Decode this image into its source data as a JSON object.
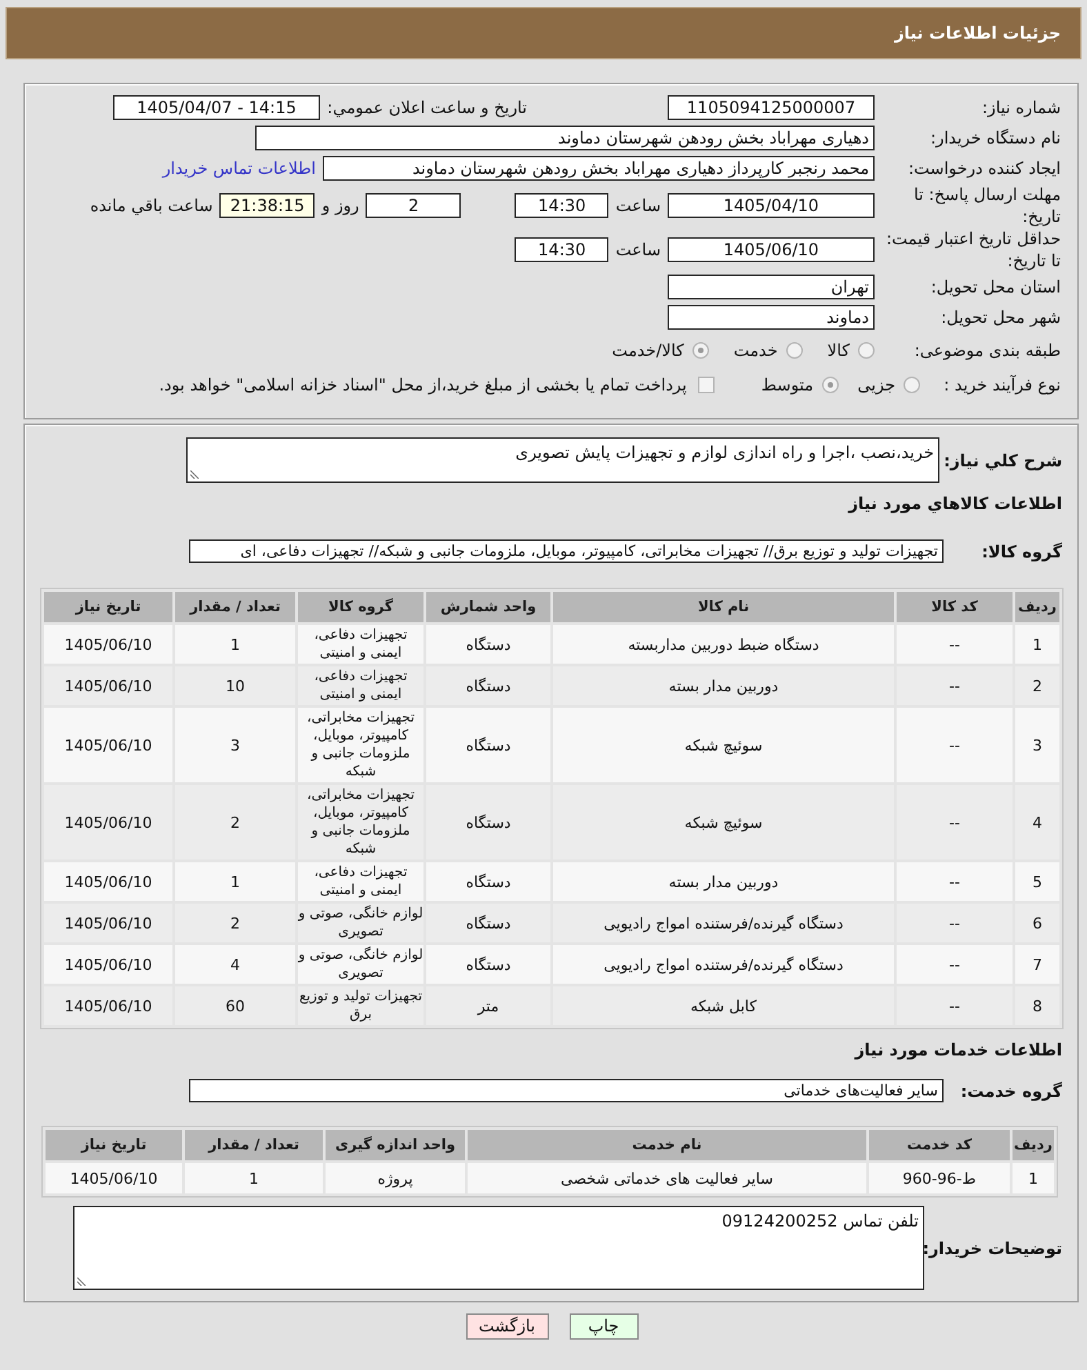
{
  "header": {
    "title": "جزئیات اطلاعات نیاز"
  },
  "details": {
    "need_number": {
      "label": "شماره نیاز:",
      "value": "1105094125000007"
    },
    "announcement": {
      "label": "تاریخ و ساعت اعلان عمومي:",
      "value": "1405/04/07 - 14:15"
    },
    "buyer_org": {
      "label": "نام دستگاه خریدار:",
      "value": "دهیاری مهراباد بخش رودهن شهرستان دماوند"
    },
    "requester": {
      "label": "ایجاد کننده درخواست:",
      "value": "محمد رنجبر کارپرداز دهیاری مهراباد بخش رودهن شهرستان دماوند",
      "link": "اطلاعات تماس خریدار"
    },
    "deadline": {
      "label": "مهلت ارسال پاسخ: تا تاریخ:",
      "date": "1405/04/10",
      "time_label": "ساعت",
      "time": "14:30",
      "days": "2",
      "days_label": "روز و",
      "remaining": "21:38:15",
      "remaining_label": "ساعت باقي مانده"
    },
    "price_validity": {
      "label": "حداقل تاریخ اعتبار قیمت: تا تاریخ:",
      "date": "1405/06/10",
      "time_label": "ساعت",
      "time": "14:30"
    },
    "province": {
      "label": "استان محل تحویل:",
      "value": "تهران"
    },
    "city": {
      "label": "شهر محل تحویل:",
      "value": "دماوند"
    },
    "category": {
      "label": "طبقه بندی موضوعی:",
      "options": [
        {
          "label": "کالا",
          "selected": false
        },
        {
          "label": "خدمت",
          "selected": false
        },
        {
          "label": "کالا/خدمت",
          "selected": true
        }
      ]
    },
    "process": {
      "label": "نوع فرآیند خرید :",
      "options": [
        {
          "label": "جزیی",
          "selected": false
        },
        {
          "label": "متوسط",
          "selected": true
        }
      ],
      "treasury": {
        "label": "پرداخت تمام یا بخشی از مبلغ خرید،از محل \"اسناد خزانه اسلامی\" خواهد بود.",
        "checked": false
      }
    }
  },
  "description": {
    "label": "شرح کلي نیاز:",
    "value": "خرید،نصب ،اجرا و راه اندازی لوازم و تجهیزات پایش تصویری"
  },
  "goods": {
    "heading": "اطلاعات کالاهاي مورد نیاز",
    "group_label": "گروه کالا:",
    "group_value": "تجهیزات تولید و توزیع برق// تجهیزات مخابراتی، کامپیوتر، موبایل، ملزومات جانبی و شبکه// تجهیزات دفاعی، ای",
    "table": {
      "columns": [
        "ردیف",
        "کد کالا",
        "نام کالا",
        "واحد شمارش",
        "گروه کالا",
        "تعداد / مقدار",
        "تاریخ نیاز"
      ],
      "rows": [
        {
          "cells": [
            "1",
            "--",
            "دستگاه ضبط دوربین مداربسته",
            "دستگاه",
            "تجهیزات دفاعی، ایمنی و امنیتی",
            "1",
            "1405/06/10"
          ]
        },
        {
          "cells": [
            "2",
            "--",
            "دوربین مدار بسته",
            "دستگاه",
            "تجهیزات دفاعی، ایمنی و امنیتی",
            "10",
            "1405/06/10"
          ]
        },
        {
          "cells": [
            "3",
            "--",
            "سوئیچ شبکه",
            "دستگاه",
            "تجهیزات مخابراتی، کامپیوتر، موبایل، ملزومات جانبی و شبکه",
            "3",
            "1405/06/10"
          ]
        },
        {
          "cells": [
            "4",
            "--",
            "سوئیچ شبکه",
            "دستگاه",
            "تجهیزات مخابراتی، کامپیوتر، موبایل، ملزومات جانبی و شبکه",
            "2",
            "1405/06/10"
          ]
        },
        {
          "cells": [
            "5",
            "--",
            "دوربین مدار بسته",
            "دستگاه",
            "تجهیزات دفاعی، ایمنی و امنیتی",
            "1",
            "1405/06/10"
          ]
        },
        {
          "cells": [
            "6",
            "--",
            "دستگاه گیرنده/فرستنده امواج رادیویی",
            "دستگاه",
            "لوازم خانگی، صوتی و تصویری",
            "2",
            "1405/06/10"
          ]
        },
        {
          "cells": [
            "7",
            "--",
            "دستگاه گیرنده/فرستنده امواج رادیویی",
            "دستگاه",
            "لوازم خانگی، صوتی و تصویری",
            "4",
            "1405/06/10"
          ]
        },
        {
          "cells": [
            "8",
            "--",
            "کابل شبکه",
            "متر",
            "تجهیزات تولید و توزیع برق",
            "60",
            "1405/06/10"
          ]
        }
      ]
    }
  },
  "services": {
    "heading": "اطلاعات خدمات مورد نیاز",
    "group_label": "گروه خدمت:",
    "group_value": "سایر فعالیت‌های خدماتی",
    "table": {
      "columns": [
        "ردیف",
        "کد خدمت",
        "نام خدمت",
        "واحد اندازه گیری",
        "تعداد / مقدار",
        "تاریخ نیاز"
      ],
      "rows": [
        {
          "cells": [
            "1",
            "ط-96-960",
            "سایر فعالیت های خدماتی شخصی",
            "پروژه",
            "1",
            "1405/06/10"
          ]
        }
      ]
    }
  },
  "buyer_notes": {
    "label": "توضیحات خریدار:",
    "value": "تلفن تماس 09124200252"
  },
  "buttons": [
    {
      "label": "چاپ",
      "kind": "print"
    },
    {
      "label": "بازگشت",
      "kind": "back"
    }
  ]
}
